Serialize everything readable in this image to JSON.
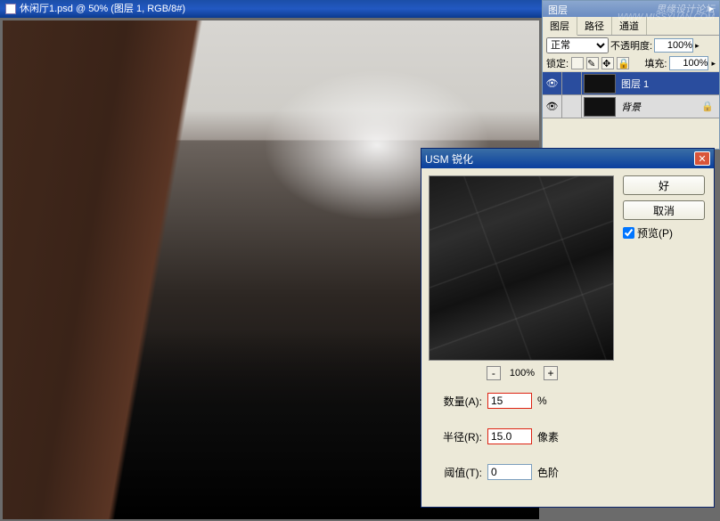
{
  "watermark": {
    "line1": "思缘设计论坛",
    "line2": "WWW.MISSYUAN.COM"
  },
  "doc": {
    "title": "休闲厅1.psd @ 50% (图层 1, RGB/8#)"
  },
  "layers_panel": {
    "title": "图层",
    "tabs": [
      "图层",
      "路径",
      "通道"
    ],
    "blend_mode": "正常",
    "opacity_label": "不透明度:",
    "opacity_value": "100%",
    "lock_label": "锁定:",
    "fill_label": "填充:",
    "fill_value": "100%",
    "layers": [
      {
        "name": "图层 1",
        "active": true,
        "locked": false
      },
      {
        "name": "背景",
        "active": false,
        "locked": true
      }
    ]
  },
  "dialog": {
    "title": "USM 锐化",
    "ok": "好",
    "cancel": "取消",
    "preview_label": "预览(P)",
    "zoom_minus": "-",
    "zoom_value": "100%",
    "zoom_plus": "+",
    "amount_label": "数量(A):",
    "amount_value": "15",
    "amount_unit": "%",
    "radius_label": "半径(R):",
    "radius_value": "15.0",
    "radius_unit": "像素",
    "threshold_label": "阈值(T):",
    "threshold_value": "0",
    "threshold_unit": "色阶"
  }
}
